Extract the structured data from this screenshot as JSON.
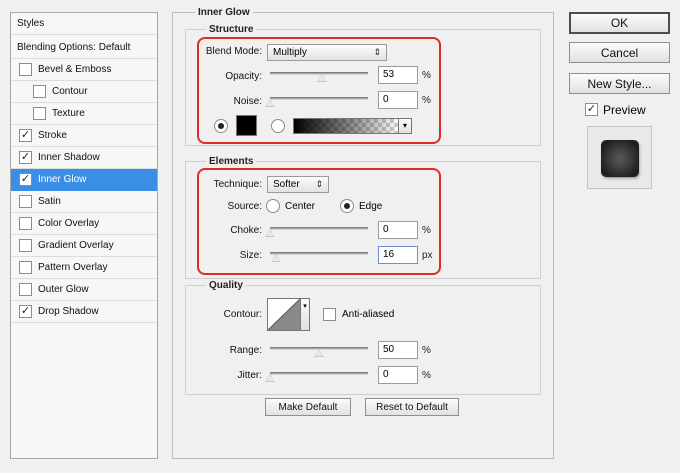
{
  "styles_list": {
    "header": "Styles",
    "blending": "Blending Options: Default",
    "items": [
      {
        "label": "Bevel & Emboss",
        "checked": false,
        "sub": false
      },
      {
        "label": "Contour",
        "checked": false,
        "sub": true
      },
      {
        "label": "Texture",
        "checked": false,
        "sub": true
      },
      {
        "label": "Stroke",
        "checked": true,
        "sub": false
      },
      {
        "label": "Inner Shadow",
        "checked": true,
        "sub": false
      },
      {
        "label": "Inner Glow",
        "checked": true,
        "sub": false,
        "selected": true
      },
      {
        "label": "Satin",
        "checked": false,
        "sub": false
      },
      {
        "label": "Color Overlay",
        "checked": false,
        "sub": false
      },
      {
        "label": "Gradient Overlay",
        "checked": false,
        "sub": false
      },
      {
        "label": "Pattern Overlay",
        "checked": false,
        "sub": false
      },
      {
        "label": "Outer Glow",
        "checked": false,
        "sub": false
      },
      {
        "label": "Drop Shadow",
        "checked": true,
        "sub": false
      }
    ]
  },
  "inner_glow": {
    "title": "Inner Glow",
    "structure": {
      "title": "Structure",
      "blend_mode_label": "Blend Mode:",
      "blend_mode_value": "Multiply",
      "opacity_label": "Opacity:",
      "opacity_value": "53",
      "opacity_level": 53,
      "noise_label": "Noise:",
      "noise_value": "0",
      "noise_level": 0,
      "unit": "%",
      "color": "#000000"
    },
    "elements": {
      "title": "Elements",
      "technique_label": "Technique:",
      "technique_value": "Softer",
      "source_label": "Source:",
      "source_center": "Center",
      "source_edge": "Edge",
      "choke_label": "Choke:",
      "choke_value": "0",
      "choke_level": 0,
      "size_label": "Size:",
      "size_value": "16",
      "size_level": 6,
      "percent": "%",
      "px": "px"
    },
    "quality": {
      "title": "Quality",
      "contour_label": "Contour:",
      "anti_aliased": "Anti-aliased",
      "range_label": "Range:",
      "range_value": "50",
      "range_level": 50,
      "jitter_label": "Jitter:",
      "jitter_value": "0",
      "jitter_level": 0,
      "unit": "%"
    },
    "make_default": "Make Default",
    "reset_default": "Reset to Default"
  },
  "buttons": {
    "ok": "OK",
    "cancel": "Cancel",
    "new_style": "New Style...",
    "preview": "Preview"
  },
  "colors": {
    "selection": "#3a8ee6",
    "highlight": "#e02a2a"
  }
}
